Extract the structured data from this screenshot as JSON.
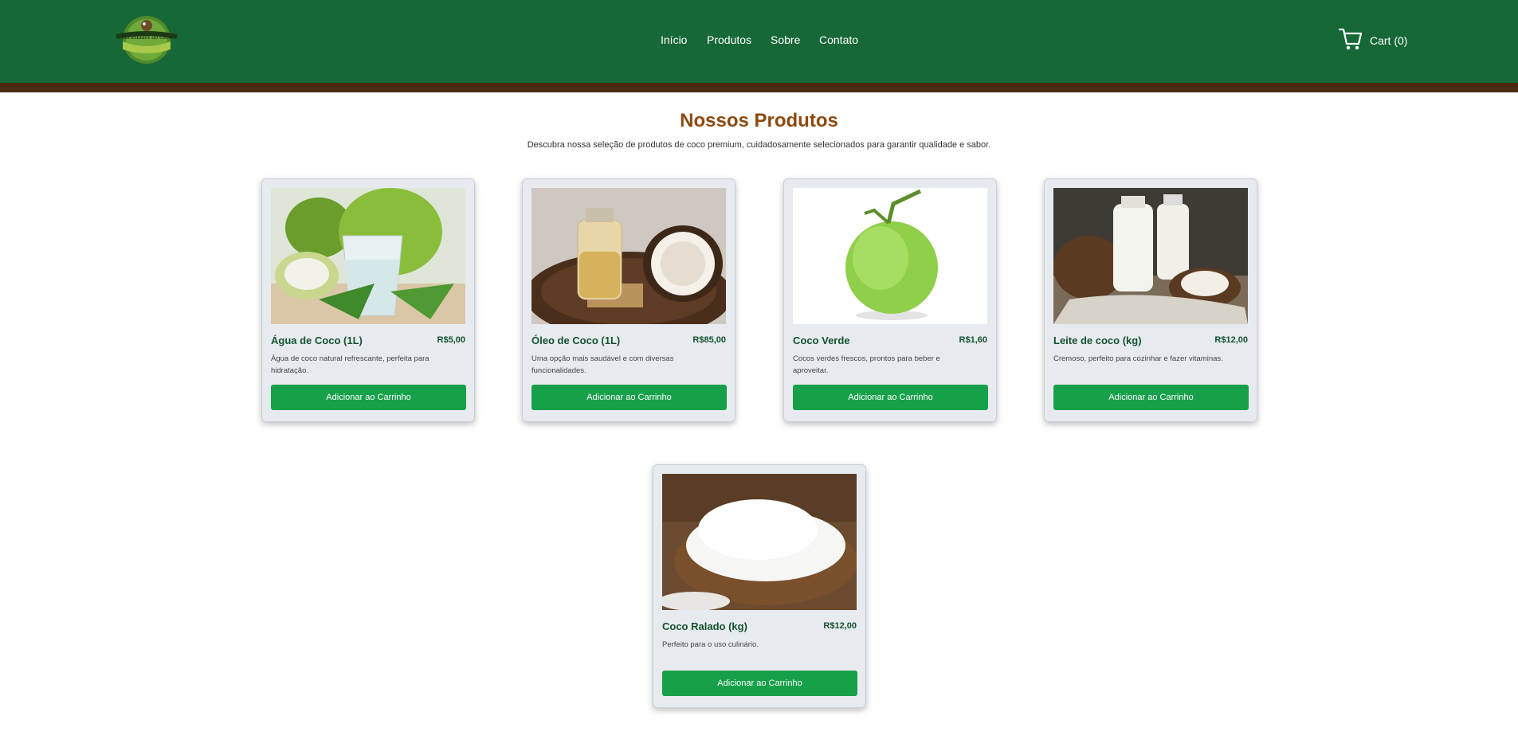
{
  "header": {
    "logo_alt": "Variedades do coco",
    "nav": [
      "Início",
      "Produtos",
      "Sobre",
      "Contato"
    ],
    "cart_label": "Cart (0)"
  },
  "main": {
    "title": "Nossos Produtos",
    "subtitle": "Descubra nossa seleção de produtos de coco premium, cuidadosamente selecionados para garantir qualidade e sabor."
  },
  "products": [
    {
      "name": "Água de Coco (1L)",
      "price": "R$5,00",
      "description": "Água de coco natural refrescante, perfeita para hidratação.",
      "button": "Adicionar ao Carrinho"
    },
    {
      "name": "Óleo de Coco (1L)",
      "price": "R$85,00",
      "description": "Uma opção mais saudável e com diversas funcionalidades.",
      "button": "Adicionar ao Carrinho"
    },
    {
      "name": "Coco Verde",
      "price": "R$1,60",
      "description": "Cocos verdes frescos, prontos para beber e aproveitar.",
      "button": "Adicionar ao Carrinho"
    },
    {
      "name": "Leite de coco (kg)",
      "price": "R$12,00",
      "description": "Cremoso, perfeito para cozinhar e fazer vitaminas.",
      "button": "Adicionar ao Carrinho"
    },
    {
      "name": "Coco Ralado (kg)",
      "price": "R$12,00",
      "description": "Perfeito para o uso culinário.",
      "button": "Adicionar ao Carrinho"
    }
  ],
  "colors": {
    "header": "#176837",
    "stripe": "#4a2a12",
    "title": "#8a4a10",
    "button": "#17a04a",
    "card_bg": "#e7ebf0"
  },
  "icons": [
    "cart-icon",
    "logo-image"
  ]
}
